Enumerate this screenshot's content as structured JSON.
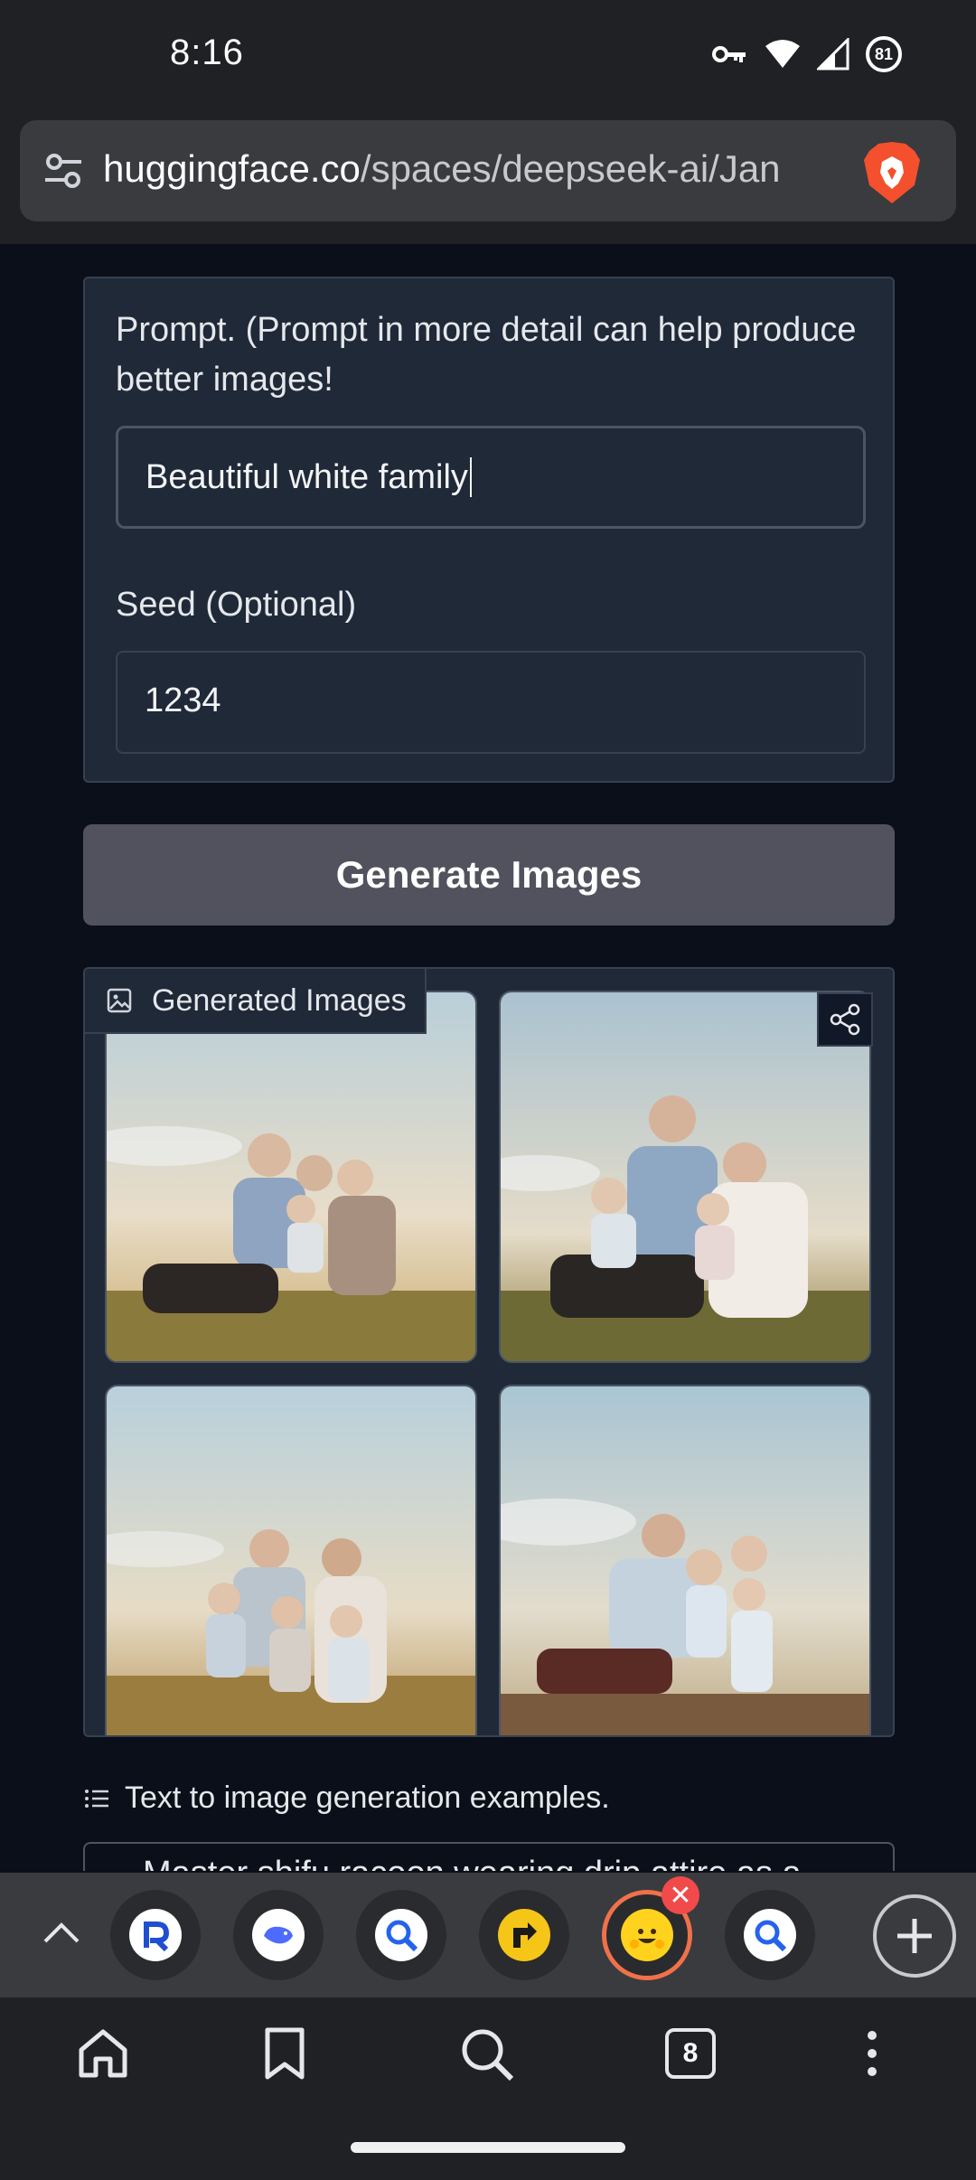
{
  "status_bar": {
    "time": "8:16",
    "battery_level": "81"
  },
  "browser": {
    "url_host": "huggingface.co",
    "url_path": "/spaces/deepseek-ai/Jan",
    "accent": "#f0714a"
  },
  "form": {
    "prompt_label": "Prompt. (Prompt in more detail can help produce better images!",
    "prompt_value": "Beautiful white family",
    "seed_label": "Seed (Optional)",
    "seed_value": "1234",
    "generate_label": "Generate Images"
  },
  "gallery": {
    "label": "Generated Images",
    "images": [
      {
        "description": "Generated image 1"
      },
      {
        "description": "Generated image 2"
      },
      {
        "description": "Generated image 3"
      },
      {
        "description": "Generated image 4"
      }
    ]
  },
  "examples": {
    "label": "Text to image generation examples.",
    "first_example": "Master shifu racoon wearing drip attire as a"
  },
  "tabstrip": {
    "tab_count": "8",
    "tabs": [
      {
        "icon": "perplexity-favicon"
      },
      {
        "icon": "deepseek-favicon"
      },
      {
        "icon": "search-favicon"
      },
      {
        "icon": "yellow-app-favicon"
      },
      {
        "icon": "huggingface-favicon",
        "active": true
      },
      {
        "icon": "search-favicon"
      }
    ]
  }
}
